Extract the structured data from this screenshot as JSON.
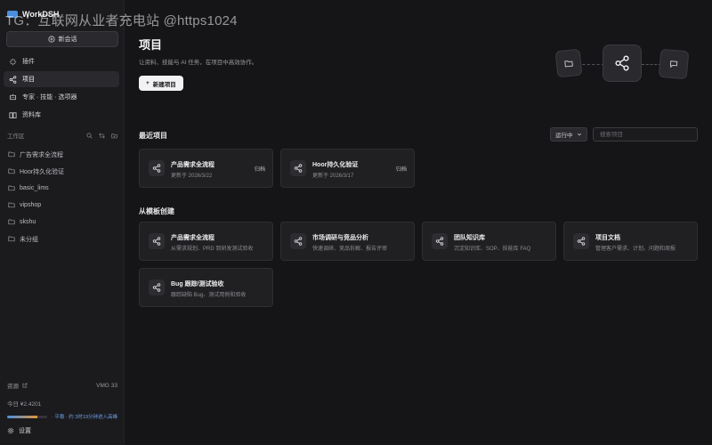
{
  "watermark": "TG：互联网从业者充电站 @https1024",
  "app": {
    "name": "WorkDSH"
  },
  "sidebar": {
    "new_chat": "新会话",
    "nav": [
      {
        "label": "插件",
        "icon": "plug-icon"
      },
      {
        "label": "项目",
        "icon": "share-icon"
      },
      {
        "label": "专家 · 技能 · 选项器",
        "icon": "experts-icon"
      },
      {
        "label": "资料库",
        "icon": "book-icon"
      }
    ],
    "workspace_label": "工作区",
    "workspaces": [
      "广告需求全流程",
      "Hoor持久化验证",
      "basic_lims",
      "vipshop",
      "skshu",
      "未分组"
    ],
    "footer": {
      "left_label": "资源",
      "right_label": "VMG 33",
      "quota_label": "今日 ¥2.4201",
      "quota_fill": 0.75,
      "bar_note": "· 平稳 · 约 3时19分钟进入高峰"
    },
    "settings": "设置"
  },
  "main": {
    "title": "项目",
    "subtitle": "让资料、技能与 AI 任务，在项目中高效协作。",
    "new_project": "新建项目",
    "recent_title": "最近项目",
    "sort_label": "运行中",
    "search_placeholder": "搜索项目",
    "recent": [
      {
        "title": "产品需求全流程",
        "sub": "更新于 2026/3/22",
        "tag": "归档"
      },
      {
        "title": "Hoor持久化验证",
        "sub": "更新于 2026/3/17",
        "tag": "归档"
      }
    ],
    "templates_title": "从模板创建",
    "templates": [
      {
        "title": "产品需求全流程",
        "sub": "从需求规划、PRD 到研发测试验收"
      },
      {
        "title": "市场调研与竞品分析",
        "sub": "快速调研、竞品拆解、报告评审"
      },
      {
        "title": "团队知识库",
        "sub": "沉淀知识库、SOP、技能库 FAQ"
      },
      {
        "title": "项目文档",
        "sub": "管理客户需求、计划、问题和周报"
      },
      {
        "title": "Bug 跟踪/测试验收",
        "sub": "跟踪缺陷 Bug、测试用例和验收"
      }
    ]
  }
}
